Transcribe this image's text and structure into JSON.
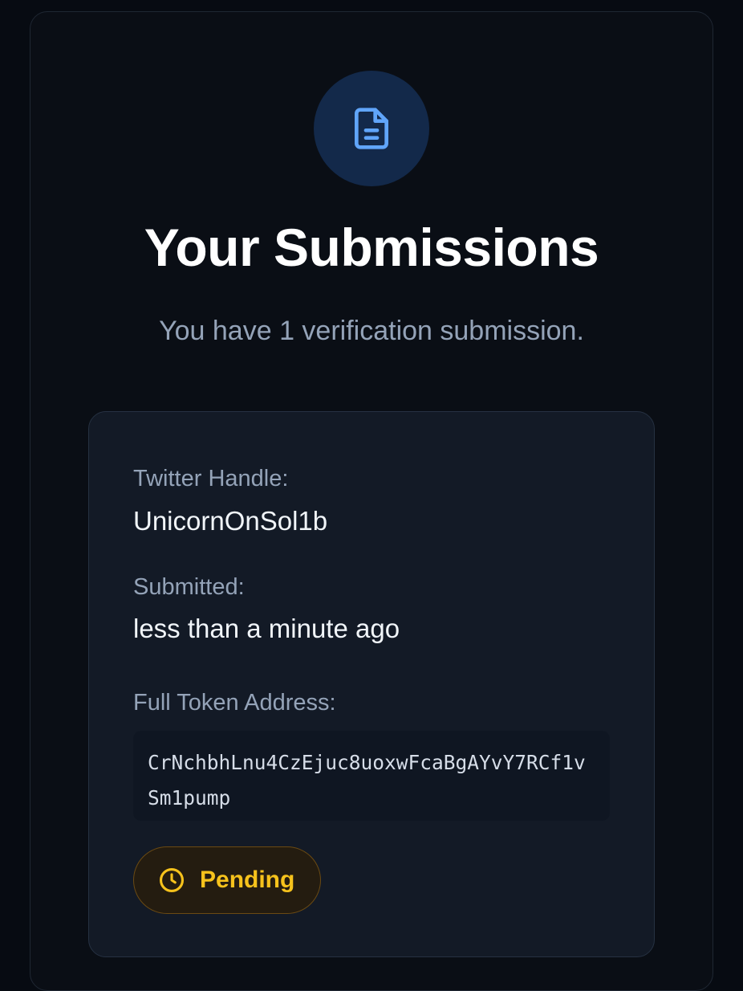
{
  "header": {
    "icon": "document-icon",
    "title": "Your Submissions",
    "subtitle": "You have 1 verification submission."
  },
  "submission": {
    "twitter_label": "Twitter Handle:",
    "twitter_value": "UnicornOnSol1b",
    "submitted_label": "Submitted:",
    "submitted_value": "less than a minute ago",
    "address_label": "Full Token Address:",
    "address_value": "CrNchbhLnu4CzEjuc8uoxwFcaBgAYvY7RCf1vSm1pump",
    "status": {
      "icon": "clock-icon",
      "label": "Pending"
    }
  },
  "colors": {
    "background": "#070b12",
    "accent_blue": "#60a5fa",
    "pending_yellow": "#f6c21c"
  }
}
